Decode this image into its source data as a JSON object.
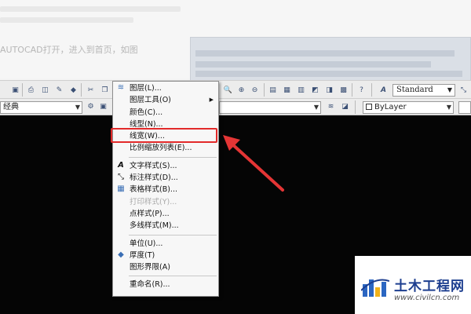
{
  "article": {
    "intro_text": "AUTOCAD打开，进入到首页，如图"
  },
  "toolbar": {
    "workspace_value": "经典",
    "layer_value": "ByLayer",
    "text_style_value": "Standard"
  },
  "menu": {
    "items": [
      {
        "label": "图层(L)...",
        "icon": "layers-icon",
        "enabled": true
      },
      {
        "label": "图层工具(O)",
        "icon": "",
        "submenu": true,
        "enabled": true
      },
      {
        "label": "颜色(C)...",
        "icon": "",
        "enabled": true
      },
      {
        "label": "线型(N)...",
        "icon": "",
        "enabled": true
      },
      {
        "label": "线宽(W)...",
        "icon": "",
        "enabled": true,
        "highlighted": true
      },
      {
        "label": "比例缩放列表(E)...",
        "icon": "",
        "enabled": true
      },
      {
        "label": "文字样式(S)...",
        "icon": "text-style-icon",
        "enabled": true
      },
      {
        "label": "标注样式(D)...",
        "icon": "dimension-style-icon",
        "enabled": true
      },
      {
        "label": "表格样式(B)...",
        "icon": "table-style-icon",
        "enabled": true
      },
      {
        "label": "打印样式(Y)...",
        "icon": "",
        "enabled": false
      },
      {
        "label": "点样式(P)...",
        "icon": "",
        "enabled": true
      },
      {
        "label": "多线样式(M)...",
        "icon": "",
        "enabled": true
      },
      {
        "label": "单位(U)...",
        "icon": "",
        "enabled": true
      },
      {
        "label": "厚度(T)",
        "icon": "thickness-icon",
        "enabled": true
      },
      {
        "label": "图形界限(A)",
        "icon": "",
        "enabled": true
      },
      {
        "label": "重命名(R)...",
        "icon": "",
        "enabled": true
      }
    ]
  },
  "annotation": {
    "highlight_color": "#e22a2a",
    "arrow_color": "#e43535"
  },
  "logo": {
    "name": "土木工程网",
    "url": "www.civilcn.com"
  }
}
